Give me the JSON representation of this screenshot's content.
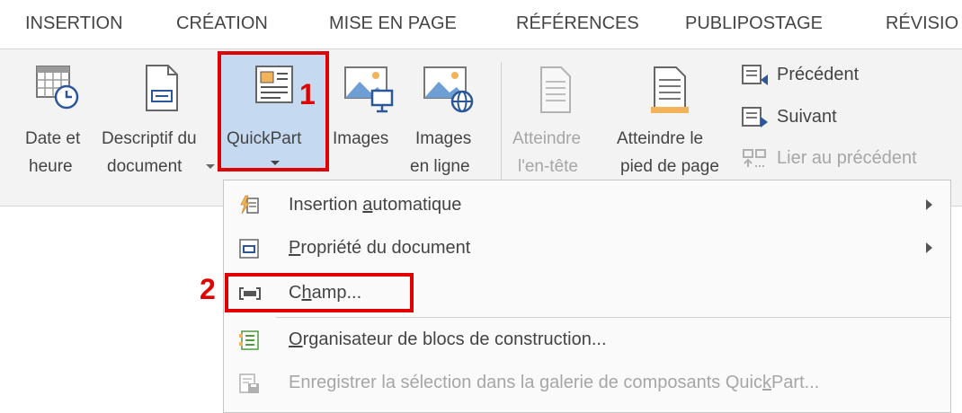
{
  "tabs": [
    "INSERTION",
    "CRÉATION",
    "MISE EN PAGE",
    "RÉFÉRENCES",
    "PUBLIPOSTAGE",
    "RÉVISIO"
  ],
  "ribbon": {
    "date_time": [
      "Date et",
      "heure"
    ],
    "doc_info": [
      "Descriptif du",
      "document"
    ],
    "quickpart": [
      "QuickPart"
    ],
    "images": [
      "Images"
    ],
    "online_images": [
      "Images",
      "en ligne"
    ],
    "goto_header": [
      "Atteindre",
      "l'en-tête"
    ],
    "goto_footer": [
      "Atteindre le",
      "pied de page"
    ],
    "previous": "Précédent",
    "next": "Suivant",
    "link_previous": "Lier au précédent"
  },
  "callouts": {
    "one": "1",
    "two": "2"
  },
  "menu": {
    "auto_text": {
      "pre": "Insertion ",
      "key": "a",
      "post": "utomatique"
    },
    "doc_property": {
      "pre": "",
      "key": "P",
      "post": "ropriété du document"
    },
    "field": {
      "pre": "C",
      "key": "h",
      "post": "amp..."
    },
    "organizer": {
      "pre": "",
      "key": "O",
      "post": "rganisateur de blocs de construction..."
    },
    "save_selection": {
      "pre": "Enregistrer la sélection dans la galerie de composants Quic",
      "key": "k",
      "post": "Part..."
    }
  },
  "colors": {
    "highlight_red": "#e10000",
    "selection_blue": "#c5d9f1",
    "icon_blue": "#2b579a",
    "icon_orange": "#f2b35a"
  }
}
